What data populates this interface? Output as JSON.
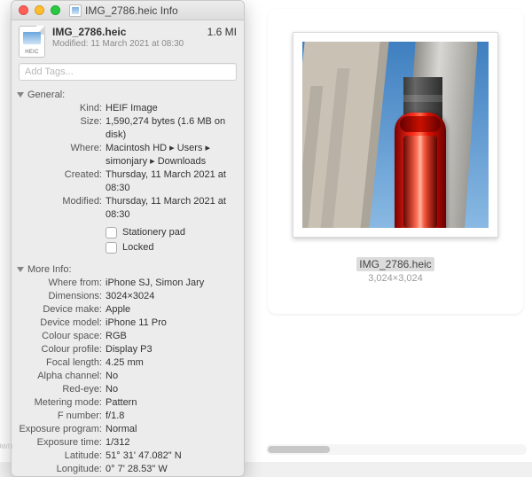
{
  "window": {
    "title": "IMG_2786.heic Info"
  },
  "header": {
    "icon_tag": "HEIC",
    "filename": "IMG_2786.heic",
    "size_short": "1.6 MI",
    "modified_line": "Modified: 11 March 2021 at 08:30"
  },
  "tags": {
    "placeholder": "Add Tags..."
  },
  "sections": {
    "general_label": "General:",
    "moreinfo_label": "More Info:"
  },
  "general": {
    "kind_k": "Kind:",
    "kind_v": "HEIF Image",
    "size_k": "Size:",
    "size_v": "1,590,274 bytes (1.6 MB on disk)",
    "where_k": "Where:",
    "where_v": "Macintosh HD ▸ Users ▸ simonjary ▸ Downloads",
    "created_k": "Created:",
    "created_v": "Thursday, 11 March 2021 at 08:30",
    "modified_k": "Modified:",
    "modified_v": "Thursday, 11 March 2021 at 08:30",
    "stationery_label": "Stationery pad",
    "locked_label": "Locked"
  },
  "moreinfo": {
    "wherefrom_k": "Where from:",
    "wherefrom_v": "iPhone SJ, Simon Jary",
    "dimensions_k": "Dimensions:",
    "dimensions_v": "3024×3024",
    "devicemake_k": "Device make:",
    "devicemake_v": "Apple",
    "devicemodel_k": "Device model:",
    "devicemodel_v": "iPhone 11 Pro",
    "colourspace_k": "Colour space:",
    "colourspace_v": "RGB",
    "colourprofile_k": "Colour profile:",
    "colourprofile_v": "Display P3",
    "focallength_k": "Focal length:",
    "focallength_v": "4.25 mm",
    "alphachannel_k": "Alpha channel:",
    "alphachannel_v": "No",
    "redeye_k": "Red-eye:",
    "redeye_v": "No",
    "meteringmode_k": "Metering mode:",
    "meteringmode_v": "Pattern",
    "fnumber_k": "F number:",
    "fnumber_v": "f/1.8",
    "exposureprogram_k": "Exposure program:",
    "exposureprogram_v": "Normal",
    "exposuretime_k": "Exposure time:",
    "exposuretime_v": "1/312",
    "latitude_k": "Latitude:",
    "latitude_v": "51° 31' 47.082\" N",
    "longitude_k": "Longitude:",
    "longitude_v": "0° 7' 28.53\" W"
  },
  "preview": {
    "filename": "IMG_2786.heic",
    "dimensions": "3,024×3,024"
  },
  "edge_text": "own"
}
